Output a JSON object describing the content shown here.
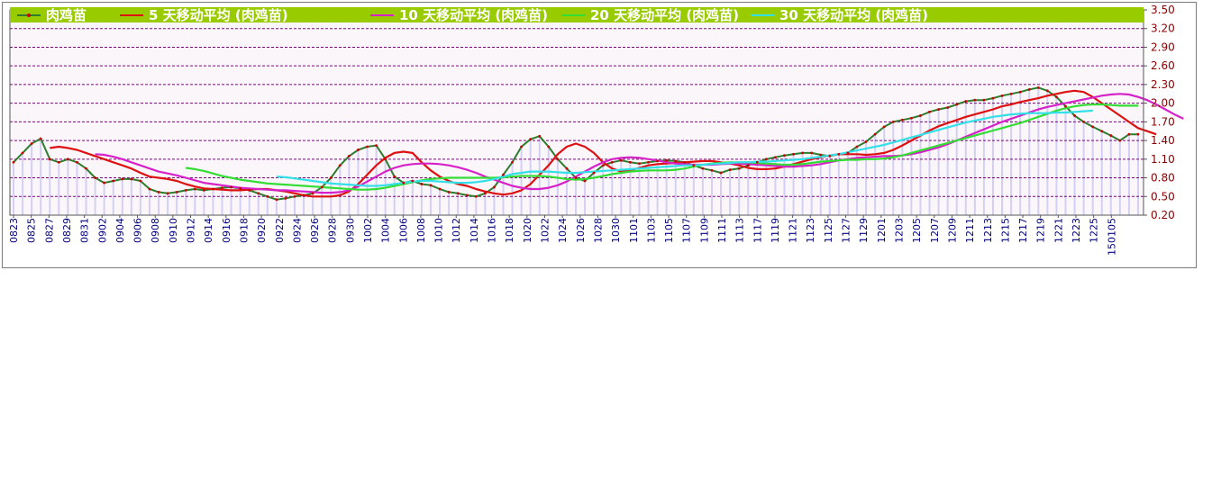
{
  "chart_data": {
    "type": "line",
    "ylim": [
      0.2,
      3.5
    ],
    "y_ticks": [
      "3.50",
      "3.20",
      "2.90",
      "2.60",
      "2.30",
      "2.00",
      "1.70",
      "1.40",
      "1.10",
      "0.80",
      "0.50",
      "0.20"
    ],
    "x_tick_labels": [
      "0823",
      "0825",
      "0827",
      "0829",
      "0831",
      "0902",
      "0904",
      "0906",
      "0908",
      "0910",
      "0912",
      "0914",
      "0916",
      "0918",
      "0920",
      "0922",
      "0924",
      "0926",
      "0928",
      "0930",
      "1002",
      "1004",
      "1006",
      "1008",
      "1010",
      "1012",
      "1014",
      "1016",
      "1018",
      "1020",
      "1022",
      "1024",
      "1026",
      "1028",
      "1030",
      "1101",
      "1103",
      "1105",
      "1107",
      "1109",
      "1111",
      "1113",
      "1117",
      "1119",
      "1121",
      "1123",
      "1125",
      "1127",
      "1129",
      "1201",
      "1203",
      "1205",
      "1207",
      "1209",
      "1211",
      "1213",
      "1215",
      "1217",
      "1219",
      "1221",
      "1223",
      "1225",
      "150105"
    ],
    "x_axis_type": "sequential",
    "legend_position": "top",
    "grid": true,
    "series": [
      {
        "name": "肉鸡苗",
        "color": "#2e7d2e",
        "marker_color": "#cc0000",
        "values": [
          1.05,
          1.2,
          1.35,
          1.43,
          1.1,
          1.05,
          1.1,
          1.05,
          0.95,
          0.8,
          0.72,
          0.75,
          0.78,
          0.78,
          0.75,
          0.62,
          0.57,
          0.55,
          0.57,
          0.6,
          0.62,
          0.6,
          0.62,
          0.64,
          0.65,
          0.63,
          0.6,
          0.55,
          0.5,
          0.45,
          0.47,
          0.5,
          0.52,
          0.55,
          0.65,
          0.8,
          1.0,
          1.15,
          1.25,
          1.3,
          1.32,
          1.1,
          0.82,
          0.72,
          0.75,
          0.7,
          0.68,
          0.62,
          0.57,
          0.55,
          0.52,
          0.5,
          0.55,
          0.65,
          0.85,
          1.05,
          1.3,
          1.42,
          1.47,
          1.3,
          1.1,
          0.95,
          0.8,
          0.75,
          0.88,
          1.0,
          1.05,
          1.08,
          1.05,
          1.03,
          1.05,
          1.07,
          1.08,
          1.07,
          1.05,
          1.0,
          0.95,
          0.92,
          0.88,
          0.93,
          0.95,
          1.0,
          1.05,
          1.1,
          1.13,
          1.16,
          1.18,
          1.2,
          1.2,
          1.17,
          1.15,
          1.18,
          1.2,
          1.3,
          1.38,
          1.5,
          1.62,
          1.7,
          1.73,
          1.76,
          1.8,
          1.86,
          1.9,
          1.93,
          1.98,
          2.03,
          2.05,
          2.05,
          2.08,
          2.12,
          2.15,
          2.18,
          2.22,
          2.25,
          2.2,
          2.1,
          1.95,
          1.8,
          1.7,
          1.62,
          1.55,
          1.48,
          1.4,
          1.5,
          1.5
        ]
      },
      {
        "name": "5 天移动平均 (肉鸡苗)",
        "color": "#dd1111",
        "start_index": 4,
        "values": [
          1.28,
          1.3,
          1.28,
          1.25,
          1.2,
          1.15,
          1.1,
          1.05,
          1.0,
          0.95,
          0.88,
          0.82,
          0.8,
          0.78,
          0.75,
          0.7,
          0.66,
          0.63,
          0.62,
          0.61,
          0.6,
          0.6,
          0.61,
          0.62,
          0.62,
          0.6,
          0.58,
          0.55,
          0.52,
          0.5,
          0.5,
          0.5,
          0.52,
          0.58,
          0.7,
          0.85,
          1.0,
          1.12,
          1.2,
          1.22,
          1.2,
          1.05,
          0.92,
          0.82,
          0.75,
          0.7,
          0.67,
          0.62,
          0.58,
          0.55,
          0.53,
          0.55,
          0.6,
          0.7,
          0.85,
          1.0,
          1.18,
          1.3,
          1.35,
          1.3,
          1.2,
          1.05,
          0.95,
          0.9,
          0.92,
          0.96,
          1.0,
          1.02,
          1.03,
          1.04,
          1.05,
          1.06,
          1.07,
          1.07,
          1.05,
          1.03,
          1.0,
          0.96,
          0.94,
          0.94,
          0.95,
          0.98,
          1.02,
          1.06,
          1.1,
          1.13,
          1.16,
          1.18,
          1.18,
          1.18,
          1.17,
          1.18,
          1.2,
          1.25,
          1.32,
          1.4,
          1.48,
          1.56,
          1.63,
          1.68,
          1.73,
          1.78,
          1.82,
          1.86,
          1.9,
          1.95,
          1.98,
          2.02,
          2.05,
          2.08,
          2.12,
          2.15,
          2.18,
          2.2,
          2.18,
          2.1,
          2.0,
          1.9,
          1.8,
          1.7,
          1.6,
          1.55,
          1.5
        ]
      },
      {
        "name": "10 天移动平均 (肉鸡苗)",
        "color": "#d622c8",
        "start_index": 9,
        "values": [
          1.18,
          1.17,
          1.14,
          1.1,
          1.05,
          1.0,
          0.95,
          0.9,
          0.87,
          0.84,
          0.8,
          0.76,
          0.72,
          0.7,
          0.68,
          0.66,
          0.64,
          0.63,
          0.62,
          0.61,
          0.6,
          0.6,
          0.59,
          0.58,
          0.57,
          0.56,
          0.56,
          0.57,
          0.6,
          0.66,
          0.74,
          0.82,
          0.9,
          0.96,
          1.0,
          1.02,
          1.03,
          1.03,
          1.02,
          1.0,
          0.97,
          0.93,
          0.88,
          0.82,
          0.77,
          0.72,
          0.67,
          0.64,
          0.62,
          0.62,
          0.64,
          0.68,
          0.74,
          0.82,
          0.9,
          0.98,
          1.05,
          1.1,
          1.12,
          1.13,
          1.12,
          1.1,
          1.08,
          1.05,
          1.03,
          1.02,
          1.01,
          1.01,
          1.01,
          1.02,
          1.03,
          1.03,
          1.02,
          1.01,
          1.0,
          0.99,
          0.98,
          0.98,
          0.99,
          1.0,
          1.02,
          1.05,
          1.08,
          1.1,
          1.12,
          1.13,
          1.14,
          1.15,
          1.15,
          1.16,
          1.18,
          1.21,
          1.25,
          1.29,
          1.34,
          1.4,
          1.46,
          1.52,
          1.58,
          1.64,
          1.7,
          1.75,
          1.8,
          1.85,
          1.9,
          1.94,
          1.97,
          2.0,
          2.03,
          2.06,
          2.09,
          2.12,
          2.14,
          2.15,
          2.14,
          2.1,
          2.05,
          1.98,
          1.9,
          1.82,
          1.75
        ]
      },
      {
        "name": "20 天移动平均 (肉鸡苗)",
        "color": "#33dd33",
        "start_index": 19,
        "values": [
          0.96,
          0.94,
          0.91,
          0.87,
          0.83,
          0.8,
          0.77,
          0.75,
          0.73,
          0.71,
          0.7,
          0.69,
          0.68,
          0.67,
          0.66,
          0.65,
          0.64,
          0.63,
          0.62,
          0.61,
          0.61,
          0.62,
          0.64,
          0.67,
          0.7,
          0.73,
          0.76,
          0.78,
          0.79,
          0.8,
          0.8,
          0.8,
          0.8,
          0.8,
          0.8,
          0.81,
          0.82,
          0.83,
          0.83,
          0.83,
          0.82,
          0.8,
          0.78,
          0.77,
          0.78,
          0.8,
          0.83,
          0.86,
          0.88,
          0.9,
          0.91,
          0.92,
          0.92,
          0.92,
          0.93,
          0.95,
          0.98,
          1.01,
          1.03,
          1.04,
          1.05,
          1.05,
          1.05,
          1.04,
          1.03,
          1.02,
          1.01,
          1.01,
          1.02,
          1.04,
          1.06,
          1.07,
          1.08,
          1.09,
          1.09,
          1.1,
          1.1,
          1.11,
          1.13,
          1.16,
          1.2,
          1.24,
          1.28,
          1.32,
          1.36,
          1.4,
          1.44,
          1.48,
          1.52,
          1.56,
          1.6,
          1.64,
          1.68,
          1.73,
          1.78,
          1.83,
          1.88,
          1.92,
          1.95,
          1.97,
          1.98,
          1.98,
          1.97,
          1.96,
          1.96,
          1.96
        ]
      },
      {
        "name": "30 天移动平均 (肉鸡苗)",
        "color": "#33e0e8",
        "start_index": 29,
        "values": [
          0.82,
          0.81,
          0.79,
          0.77,
          0.75,
          0.73,
          0.71,
          0.7,
          0.69,
          0.68,
          0.67,
          0.67,
          0.68,
          0.7,
          0.72,
          0.74,
          0.75,
          0.75,
          0.74,
          0.73,
          0.72,
          0.72,
          0.73,
          0.75,
          0.78,
          0.82,
          0.86,
          0.88,
          0.9,
          0.9,
          0.9,
          0.89,
          0.88,
          0.88,
          0.89,
          0.9,
          0.91,
          0.92,
          0.93,
          0.94,
          0.95,
          0.96,
          0.97,
          0.98,
          0.99,
          1.0,
          1.0,
          1.01,
          1.02,
          1.03,
          1.04,
          1.05,
          1.05,
          1.06,
          1.06,
          1.07,
          1.08,
          1.09,
          1.1,
          1.12,
          1.14,
          1.16,
          1.18,
          1.21,
          1.24,
          1.27,
          1.3,
          1.33,
          1.37,
          1.41,
          1.45,
          1.49,
          1.53,
          1.57,
          1.61,
          1.65,
          1.69,
          1.72,
          1.75,
          1.78,
          1.8,
          1.82,
          1.83,
          1.84,
          1.84,
          1.84,
          1.85,
          1.85,
          1.86,
          1.87,
          1.88
        ]
      }
    ],
    "colors": {
      "plot_background": "#faf6fa",
      "grid": "#800080",
      "legend_bar": "#99cc00",
      "axis_label": "#8b0000",
      "x_label": "#000080",
      "bars": "#c7c3f0"
    }
  }
}
